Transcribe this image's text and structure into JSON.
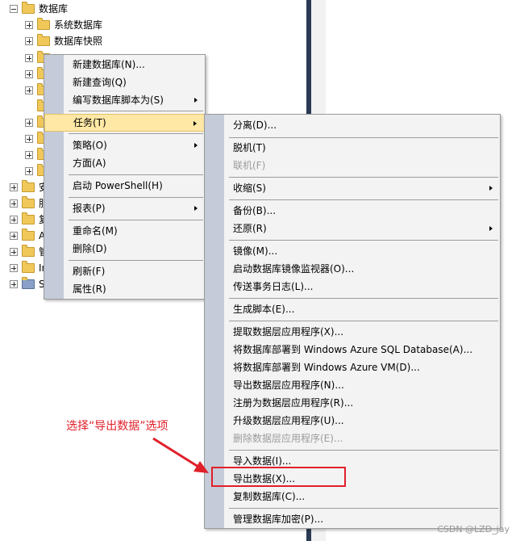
{
  "tree": {
    "rows": [
      {
        "label": "数据库",
        "expanded": true
      },
      {
        "label": "系统数据库",
        "expanded": false
      },
      {
        "label": "数据库快照",
        "expanded": false
      },
      {
        "label": "安",
        "expanded": false
      },
      {
        "label": "服",
        "expanded": false
      },
      {
        "label": "复",
        "expanded": false
      },
      {
        "label": "A",
        "expanded": false
      },
      {
        "label": "管",
        "expanded": false
      },
      {
        "label": "In",
        "expanded": false
      },
      {
        "label": "S",
        "expanded": false
      }
    ]
  },
  "context_menu": {
    "items": [
      {
        "label": "新建数据库(N)..."
      },
      {
        "label": "新建查询(Q)"
      },
      {
        "label": "编写数据库脚本为(S)",
        "submenu": true
      },
      {
        "label": "任务(T)",
        "submenu": true,
        "highlighted": true
      },
      {
        "label": "策略(O)",
        "submenu": true
      },
      {
        "label": "方面(A)"
      },
      {
        "label": "启动 PowerShell(H)"
      },
      {
        "label": "报表(P)",
        "submenu": true
      },
      {
        "label": "重命名(M)"
      },
      {
        "label": "删除(D)"
      },
      {
        "label": "刷新(F)"
      },
      {
        "label": "属性(R)"
      }
    ]
  },
  "tasks_submenu": {
    "items": [
      {
        "label": "分离(D)..."
      },
      {
        "label": "脱机(T)"
      },
      {
        "label": "联机(F)",
        "disabled": true
      },
      {
        "label": "收缩(S)",
        "submenu": true
      },
      {
        "label": "备份(B)..."
      },
      {
        "label": "还原(R)",
        "submenu": true
      },
      {
        "label": "镜像(M)..."
      },
      {
        "label": "启动数据库镜像监视器(O)..."
      },
      {
        "label": "传送事务日志(L)..."
      },
      {
        "label": "生成脚本(E)..."
      },
      {
        "label": "提取数据层应用程序(X)..."
      },
      {
        "label": "将数据库部署到 Windows Azure SQL Database(A)..."
      },
      {
        "label": "将数据库部署到 Windows Azure VM(D)..."
      },
      {
        "label": "导出数据层应用程序(N)..."
      },
      {
        "label": "注册为数据层应用程序(R)..."
      },
      {
        "label": "升级数据层应用程序(U)..."
      },
      {
        "label": "删除数据层应用程序(E)...",
        "disabled": true
      },
      {
        "label": "导入数据(I)..."
      },
      {
        "label": "导出数据(X)..."
      },
      {
        "label": "复制数据库(C)..."
      },
      {
        "label": "管理数据库加密(P)..."
      }
    ]
  },
  "annotation": {
    "text": "选择“导出数据”选项",
    "color": "#e0202a"
  },
  "watermark": "CSDN @LZD_jay"
}
